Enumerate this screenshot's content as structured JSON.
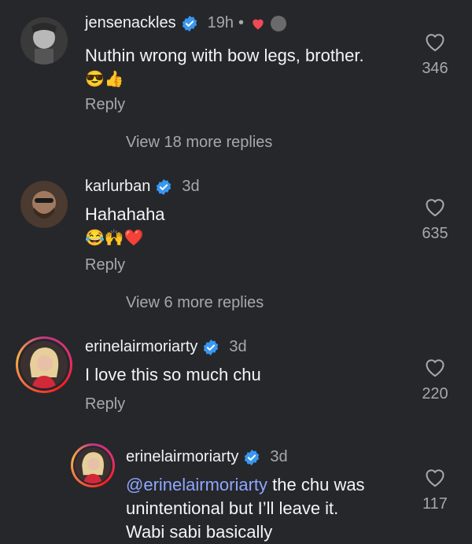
{
  "comments": [
    {
      "username": "jensenackles",
      "time": "19h",
      "dot": "•",
      "text": "Nuthin wrong with bow legs, brother.",
      "emoji": "😎👍",
      "reply": "Reply",
      "likes": "346",
      "view_more": "View 18 more replies"
    },
    {
      "username": "karlurban",
      "time": "3d",
      "text": "Hahahaha",
      "emoji": "😂🙌❤️",
      "reply": "Reply",
      "likes": "635",
      "view_more": "View 6 more replies"
    },
    {
      "username": "erinelairmoriarty",
      "time": "3d",
      "text": "I love this so much chu",
      "reply": "Reply",
      "likes": "220"
    },
    {
      "username": "erinelairmoriarty",
      "time": "3d",
      "mention": "@erinelairmoriarty",
      "text_line1": " the chu was",
      "text_line2": "unintentional but I’ll leave it.",
      "text_line3": "Wabi sabi basically",
      "likes": "117"
    }
  ],
  "colors": {
    "background": "#26272b",
    "verified": "#3897f0",
    "mention": "#8ea7ff",
    "liked_heart": "#ed4956",
    "muted_text": "#a8a8a8"
  },
  "icons": [
    "verified-badge-icon",
    "heart-outline-icon",
    "heart-filled-icon"
  ]
}
